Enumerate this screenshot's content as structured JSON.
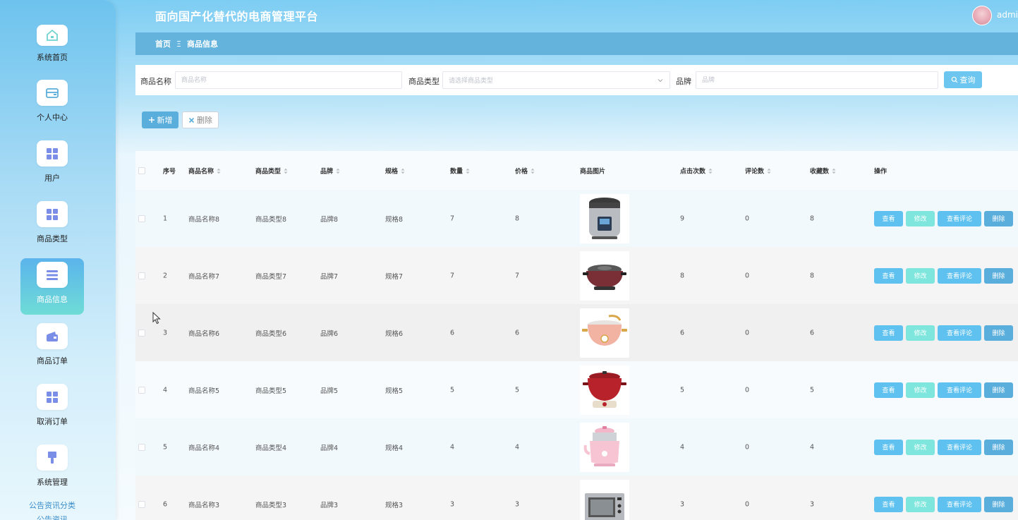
{
  "header": {
    "title": "面向国产化替代的电商管理平台",
    "username": "admi"
  },
  "sidebar": {
    "items": [
      {
        "label": "系统首页",
        "icon": "home-icon"
      },
      {
        "label": "个人中心",
        "icon": "wallet-icon"
      },
      {
        "label": "用户",
        "icon": "grid-icon"
      },
      {
        "label": "商品类型",
        "icon": "grid-icon"
      },
      {
        "label": "商品信息",
        "icon": "list-icon",
        "active": true
      },
      {
        "label": "商品订单",
        "icon": "wallet-icon"
      },
      {
        "label": "取消订单",
        "icon": "grid-icon"
      },
      {
        "label": "系统管理",
        "icon": "brush-icon"
      }
    ],
    "sub_links": [
      "公告资讯分类",
      "公告资讯"
    ]
  },
  "breadcrumb": {
    "home": "首页",
    "separator": "Ξ",
    "current": "商品信息"
  },
  "search": {
    "name_label": "商品名称",
    "name_placeholder": "商品名称",
    "type_label": "商品类型",
    "type_placeholder": "请选择商品类型",
    "brand_label": "品牌",
    "brand_placeholder": "品牌",
    "search_button": "查询"
  },
  "actions": {
    "add": "新增",
    "delete": "删除"
  },
  "table": {
    "columns": [
      "序号",
      "商品名称",
      "商品类型",
      "品牌",
      "规格",
      "数量",
      "价格",
      "商品图片",
      "点击次数",
      "评论数",
      "收藏数",
      "操作"
    ],
    "op_labels": {
      "view": "查看",
      "edit": "修改",
      "review": "查看评论",
      "delete": "删除"
    },
    "rows": [
      {
        "idx": "1",
        "name": "商品名称8",
        "type": "商品类型8",
        "brand": "品牌8",
        "spec": "规格8",
        "qty": "7",
        "price": "8",
        "clicks": "9",
        "comments": "0",
        "favs": "8",
        "image": "pressure-cooker"
      },
      {
        "idx": "2",
        "name": "商品名称7",
        "type": "商品类型7",
        "brand": "品牌7",
        "spec": "规格7",
        "qty": "7",
        "price": "7",
        "clicks": "8",
        "comments": "0",
        "favs": "8",
        "image": "hot-pot"
      },
      {
        "idx": "3",
        "name": "商品名称6",
        "type": "商品类型6",
        "brand": "品牌6",
        "spec": "规格6",
        "qty": "6",
        "price": "6",
        "clicks": "6",
        "comments": "0",
        "favs": "6",
        "image": "pink-cooker"
      },
      {
        "idx": "4",
        "name": "商品名称5",
        "type": "商品类型5",
        "brand": "品牌5",
        "spec": "规格5",
        "qty": "5",
        "price": "5",
        "clicks": "5",
        "comments": "0",
        "favs": "5",
        "image": "red-cooker"
      },
      {
        "idx": "5",
        "name": "商品名称4",
        "type": "商品类型4",
        "brand": "品牌4",
        "spec": "规格4",
        "qty": "4",
        "price": "4",
        "clicks": "4",
        "comments": "0",
        "favs": "4",
        "image": "electric-kettle"
      },
      {
        "idx": "6",
        "name": "商品名称3",
        "type": "商品类型3",
        "brand": "品牌3",
        "spec": "规格3",
        "qty": "3",
        "price": "3",
        "clicks": "3",
        "comments": "0",
        "favs": "3",
        "image": "oven"
      }
    ]
  },
  "colors": {
    "accent": "#5ec1ef",
    "edit": "#7ee6dc",
    "breadcrumb": "#63b3dd"
  }
}
